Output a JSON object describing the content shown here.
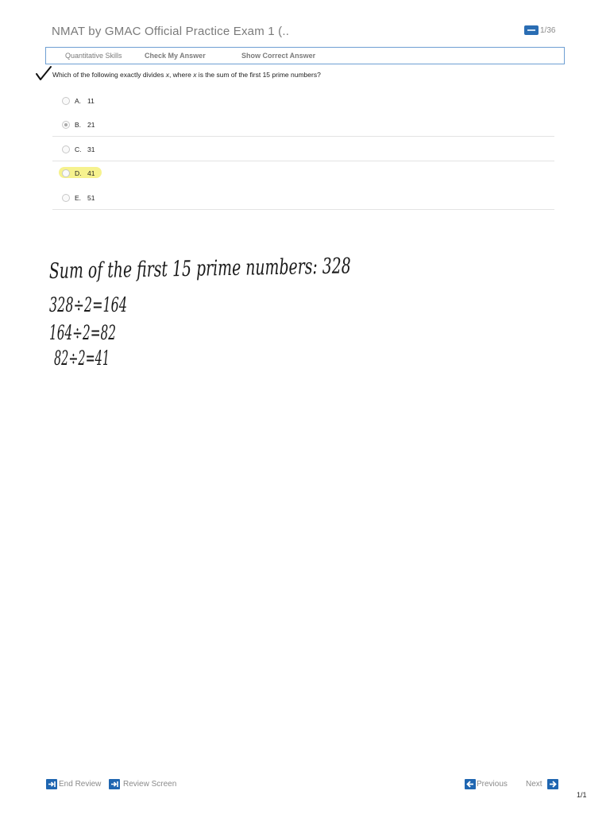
{
  "header": {
    "title": "NMAT by GMAC Official Practice Exam 1 (..",
    "page_count": "1/36"
  },
  "toolbar": {
    "section_label": "Quantitative Skills",
    "check_answer_label": "Check My Answer",
    "show_answer_label": "Show Correct Answer"
  },
  "question": {
    "text_before": "Which of the following exactly divides ",
    "var1": "x",
    "text_middle": ", where ",
    "var2": "x",
    "text_after": " is the sum of the first 15 prime numbers?"
  },
  "options": [
    {
      "letter": "A.",
      "value": "11",
      "selected": false
    },
    {
      "letter": "B.",
      "value": "21",
      "selected": true
    },
    {
      "letter": "C.",
      "value": "31",
      "selected": false
    },
    {
      "letter": "D.",
      "value": "41",
      "selected": false,
      "highlighted": true
    },
    {
      "letter": "E.",
      "value": "51",
      "selected": false
    }
  ],
  "handwritten_notes": [
    "Sum of the first 15 prime numbers: 328",
    "328÷2=164",
    "164÷2=82",
    "82÷2=41"
  ],
  "footer": {
    "end_review_label": "End Review",
    "review_screen_label": "Review Screen",
    "previous_label": "Previous",
    "next_label": "Next",
    "page_indicator": "1/1"
  },
  "colors": {
    "accent_blue": "#1f66b1",
    "toolbar_border": "#6e9fd3",
    "highlight_yellow": "#f5f07a"
  }
}
